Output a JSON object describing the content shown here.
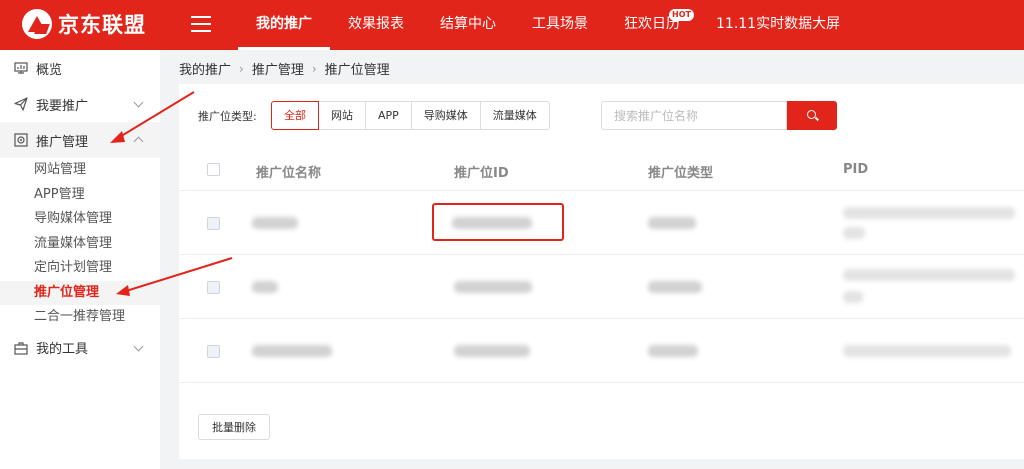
{
  "brand": {
    "name": "京东联盟",
    "accent": "#e1251b"
  },
  "topnav": [
    {
      "label": "我的推广",
      "active": true
    },
    {
      "label": "效果报表"
    },
    {
      "label": "结算中心"
    },
    {
      "label": "工具场景"
    },
    {
      "label": "狂欢日历",
      "badge": "HOT"
    },
    {
      "label": "11.11实时数据大屏"
    }
  ],
  "sidebar": {
    "groups": [
      {
        "label": "概览",
        "icon": "monitor-icon"
      },
      {
        "label": "我要推广",
        "icon": "send-icon"
      },
      {
        "label": "推广管理",
        "icon": "target-icon",
        "open": true
      },
      {
        "label": "我的工具",
        "icon": "toolbox-icon"
      }
    ],
    "sub_items": [
      "网站管理",
      "APP管理",
      "导购媒体管理",
      "流量媒体管理",
      "定向计划管理",
      "推广位管理",
      "二合一推荐管理"
    ],
    "active_sub": "推广位管理"
  },
  "breadcrumb": [
    "我的推广",
    "推广管理",
    "推广位管理"
  ],
  "filter": {
    "label": "推广位类型:",
    "tabs": [
      "全部",
      "网站",
      "APP",
      "导购媒体",
      "流量媒体"
    ],
    "active": "全部"
  },
  "search": {
    "placeholder": "搜索推广位名称"
  },
  "table": {
    "columns": [
      "推广位名称",
      "推广位ID",
      "推广位类型",
      "PID"
    ]
  },
  "actions": {
    "batch_delete": "批量删除"
  }
}
